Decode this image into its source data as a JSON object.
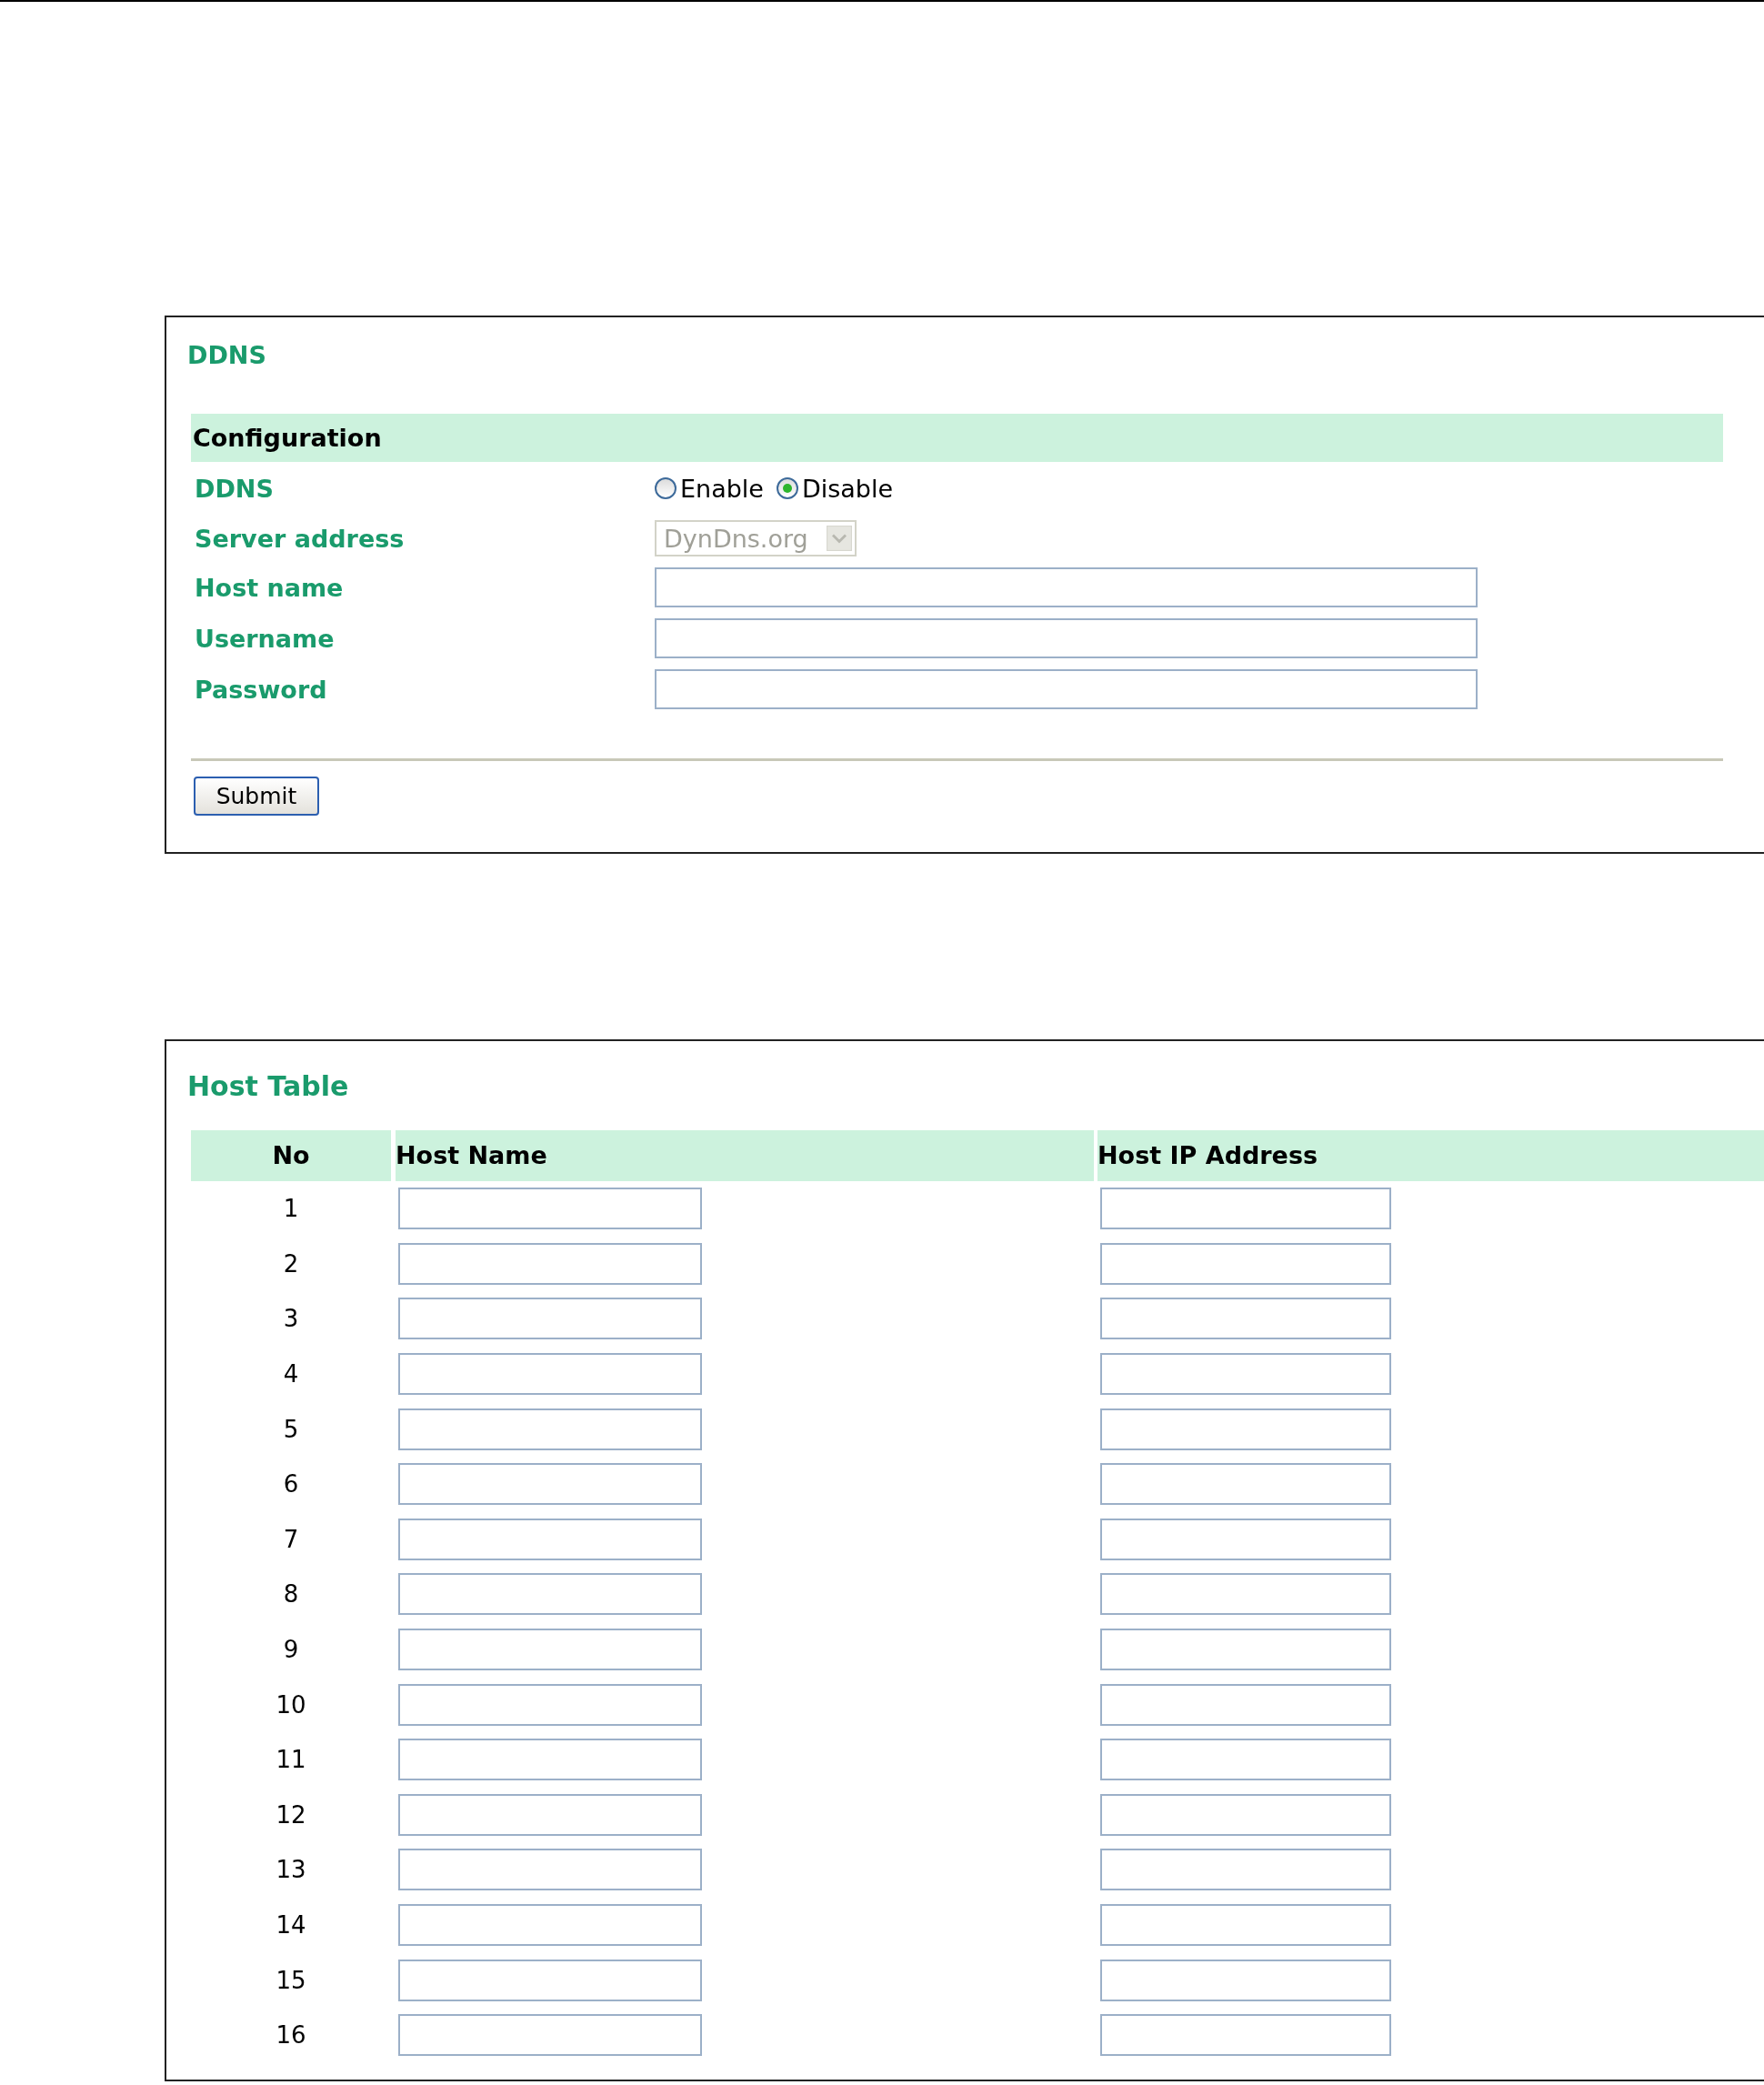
{
  "ddns_panel": {
    "title": "DDNS",
    "section": "Configuration",
    "fields": [
      {
        "kind": "radio",
        "label": "DDNS",
        "options": [
          {
            "label": "Enable",
            "selected": false
          },
          {
            "label": "Disable",
            "selected": true
          }
        ]
      },
      {
        "kind": "select",
        "label": "Server address",
        "value": "DynDns.org",
        "disabled": true
      },
      {
        "kind": "text",
        "label": "Host name"
      },
      {
        "kind": "text",
        "label": "Username"
      },
      {
        "kind": "text",
        "label": "Password"
      }
    ],
    "submit": "Submit"
  },
  "host_table": {
    "title": "Host Table",
    "columns": [
      "No",
      "Host Name",
      "Host IP Address"
    ],
    "rows": [
      {
        "no": "1"
      },
      {
        "no": "2"
      },
      {
        "no": "3"
      },
      {
        "no": "4"
      },
      {
        "no": "5"
      },
      {
        "no": "6"
      },
      {
        "no": "7"
      },
      {
        "no": "8"
      },
      {
        "no": "9"
      },
      {
        "no": "10"
      },
      {
        "no": "11"
      },
      {
        "no": "12"
      },
      {
        "no": "13"
      },
      {
        "no": "14"
      },
      {
        "no": "15"
      },
      {
        "no": "16"
      }
    ]
  }
}
